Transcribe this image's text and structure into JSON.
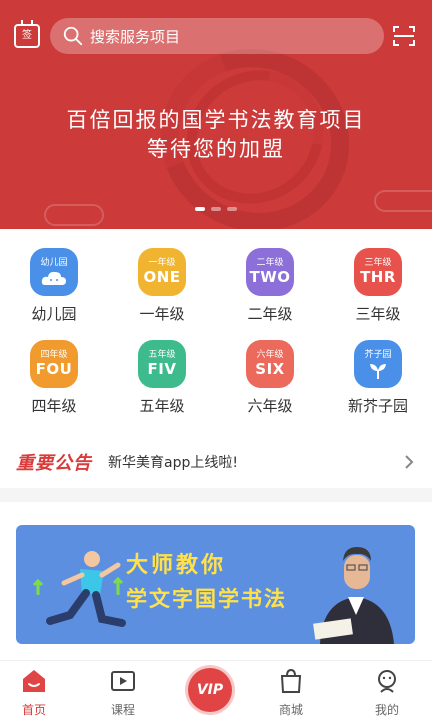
{
  "header": {
    "calendar_icon_text": "签",
    "search_placeholder": "搜索服务项目",
    "search_icon": "search-icon",
    "scan_icon": "scan-icon"
  },
  "hero": {
    "line1": "百倍回报的国学书法教育项目",
    "line2": "等待您的加盟",
    "slides": 3,
    "active_slide": 1,
    "background": "#cc3a3a"
  },
  "grades": [
    {
      "label": "幼儿园",
      "badge_top": "幼儿园",
      "badge_main": "",
      "color": "#4a90e8",
      "icon": "cloud-mascot-icon"
    },
    {
      "label": "一年级",
      "badge_top": "一年级",
      "badge_main": "ONE",
      "color": "#f0b430",
      "icon": ""
    },
    {
      "label": "二年级",
      "badge_top": "二年级",
      "badge_main": "TWO",
      "color": "#8c6fd8",
      "icon": ""
    },
    {
      "label": "三年级",
      "badge_top": "三年级",
      "badge_main": "THR",
      "color": "#e8524d",
      "icon": ""
    },
    {
      "label": "四年级",
      "badge_top": "四年级",
      "badge_main": "FOU",
      "color": "#f19a2e",
      "icon": ""
    },
    {
      "label": "五年级",
      "badge_top": "五年级",
      "badge_main": "FIV",
      "color": "#3dbb8c",
      "icon": ""
    },
    {
      "label": "六年级",
      "badge_top": "六年级",
      "badge_main": "SIX",
      "color": "#ec6a5c",
      "icon": ""
    },
    {
      "label": "新芥子园",
      "badge_top": "芥子园",
      "badge_main": "",
      "color": "#4a90e8",
      "icon": "sprout-icon"
    }
  ],
  "notice": {
    "tag": "重要公告",
    "text": "新华美育app上线啦!",
    "arrow_icon": "chevron-right-icon"
  },
  "promo": {
    "title": "大师教你",
    "subtitle": "学文字国学书法",
    "background": "#5d8fe0"
  },
  "tabbar": {
    "items": [
      {
        "label": "首页",
        "icon": "home-icon",
        "active": true
      },
      {
        "label": "课程",
        "icon": "play-icon",
        "active": false
      },
      {
        "label": "VIP",
        "icon": "vip-icon",
        "active": false
      },
      {
        "label": "商城",
        "icon": "shopping-bag-icon",
        "active": false
      },
      {
        "label": "我的",
        "icon": "profile-icon",
        "active": false
      }
    ],
    "accent": "#d93a3a"
  }
}
